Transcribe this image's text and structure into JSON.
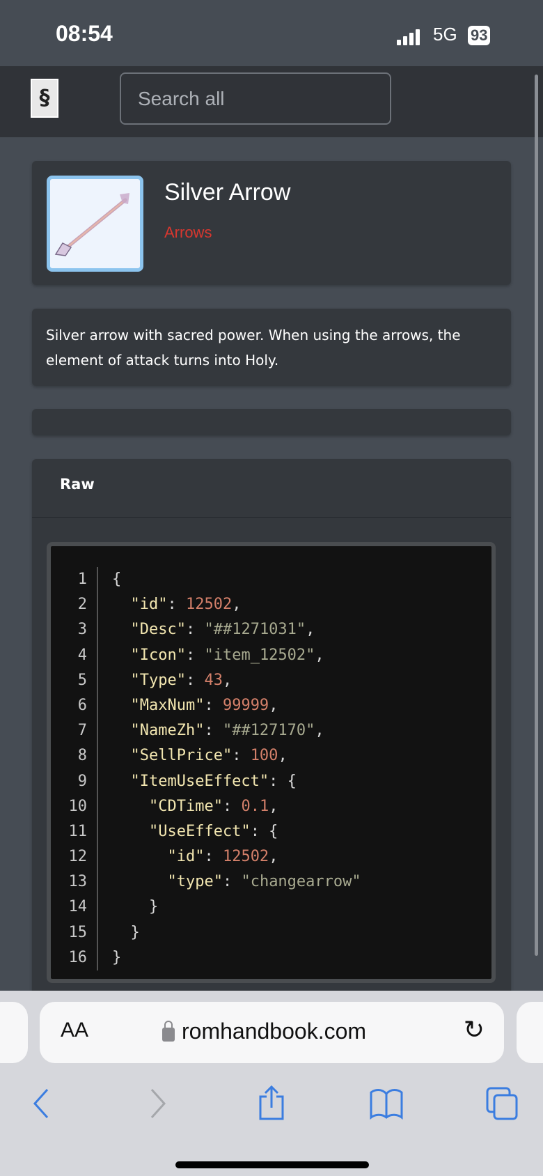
{
  "status_bar": {
    "time": "08:54",
    "network": "5G",
    "battery": "93"
  },
  "header": {
    "logo_icon": "rom-logo-icon",
    "search_placeholder": "Search all"
  },
  "item": {
    "name": "Silver Arrow",
    "category": "Arrows",
    "category_color": "#d9372f",
    "image_icon": "silver-arrow-icon",
    "description": "Silver arrow with sacred power. When using the arrows, the element of attack turns into Holy."
  },
  "raw": {
    "title": "Raw",
    "lines": [
      [
        [
          "p",
          "{"
        ]
      ],
      [
        [
          "k",
          "  \"id\""
        ],
        [
          "p",
          ": "
        ],
        [
          "n",
          "12502"
        ],
        [
          "p",
          ","
        ]
      ],
      [
        [
          "k",
          "  \"Desc\""
        ],
        [
          "p",
          ": "
        ],
        [
          "s",
          "\"##1271031\""
        ],
        [
          "p",
          ","
        ]
      ],
      [
        [
          "k",
          "  \"Icon\""
        ],
        [
          "p",
          ": "
        ],
        [
          "s",
          "\"item_12502\""
        ],
        [
          "p",
          ","
        ]
      ],
      [
        [
          "k",
          "  \"Type\""
        ],
        [
          "p",
          ": "
        ],
        [
          "n",
          "43"
        ],
        [
          "p",
          ","
        ]
      ],
      [
        [
          "k",
          "  \"MaxNum\""
        ],
        [
          "p",
          ": "
        ],
        [
          "n",
          "99999"
        ],
        [
          "p",
          ","
        ]
      ],
      [
        [
          "k",
          "  \"NameZh\""
        ],
        [
          "p",
          ": "
        ],
        [
          "s",
          "\"##127170\""
        ],
        [
          "p",
          ","
        ]
      ],
      [
        [
          "k",
          "  \"SellPrice\""
        ],
        [
          "p",
          ": "
        ],
        [
          "n",
          "100"
        ],
        [
          "p",
          ","
        ]
      ],
      [
        [
          "k",
          "  \"ItemUseEffect\""
        ],
        [
          "p",
          ": {"
        ]
      ],
      [
        [
          "k",
          "    \"CDTime\""
        ],
        [
          "p",
          ": "
        ],
        [
          "n",
          "0.1"
        ],
        [
          "p",
          ","
        ]
      ],
      [
        [
          "k",
          "    \"UseEffect\""
        ],
        [
          "p",
          ": {"
        ]
      ],
      [
        [
          "k",
          "      \"id\""
        ],
        [
          "p",
          ": "
        ],
        [
          "n",
          "12502"
        ],
        [
          "p",
          ","
        ]
      ],
      [
        [
          "k",
          "      \"type\""
        ],
        [
          "p",
          ": "
        ],
        [
          "s",
          "\"changearrow\""
        ]
      ],
      [
        [
          "p",
          "    }"
        ]
      ],
      [
        [
          "p",
          "  }"
        ]
      ],
      [
        [
          "p",
          "}"
        ]
      ]
    ]
  },
  "browser": {
    "text_size_label": "AA",
    "url": "romhandbook.com",
    "accent": "#3b7de0"
  }
}
